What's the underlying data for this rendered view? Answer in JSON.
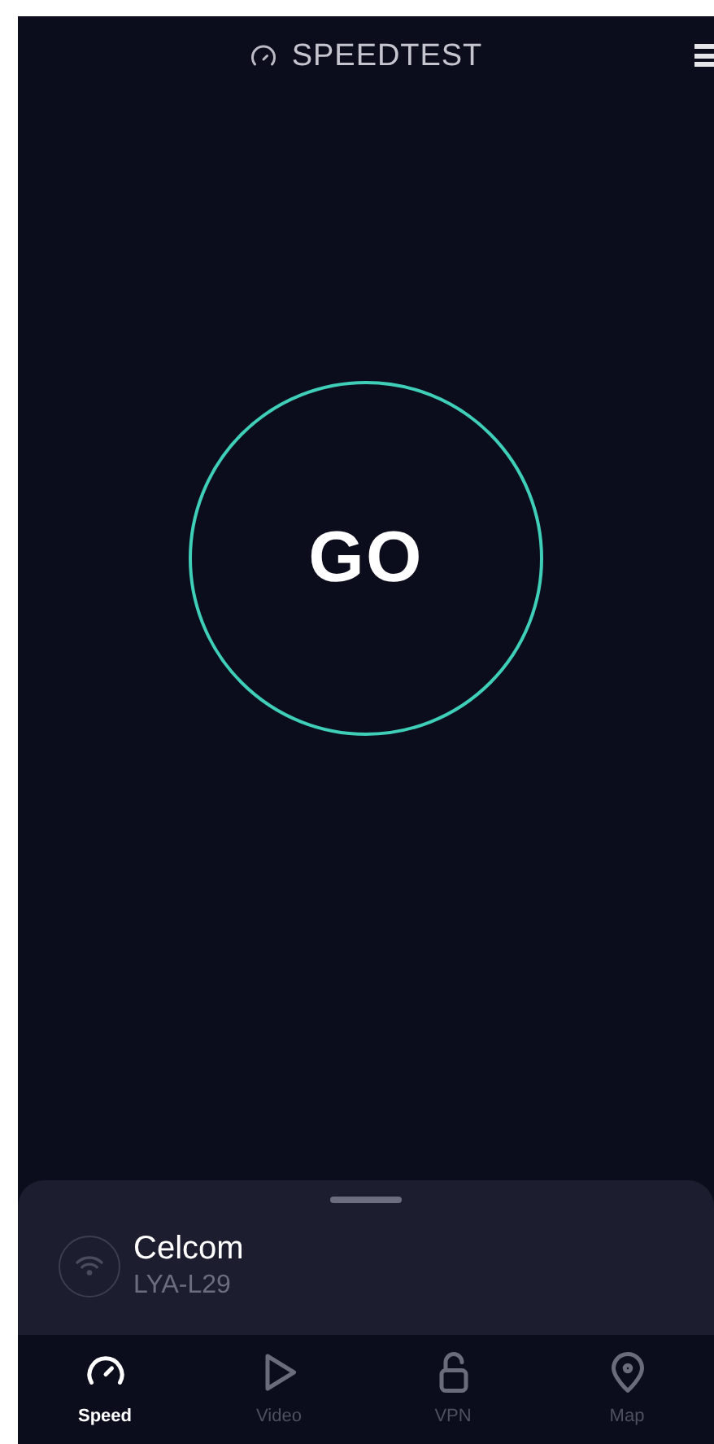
{
  "header": {
    "title": "SPEEDTEST"
  },
  "go_button": {
    "label": "GO"
  },
  "connection": {
    "provider": "Celcom",
    "device": "LYA-L29"
  },
  "tabs": [
    {
      "kind": "speed",
      "label": "Speed",
      "selected": true
    },
    {
      "kind": "video",
      "label": "Video",
      "selected": false
    },
    {
      "kind": "vpn",
      "label": "VPN",
      "selected": false
    },
    {
      "kind": "map",
      "label": "Map",
      "selected": false
    }
  ]
}
